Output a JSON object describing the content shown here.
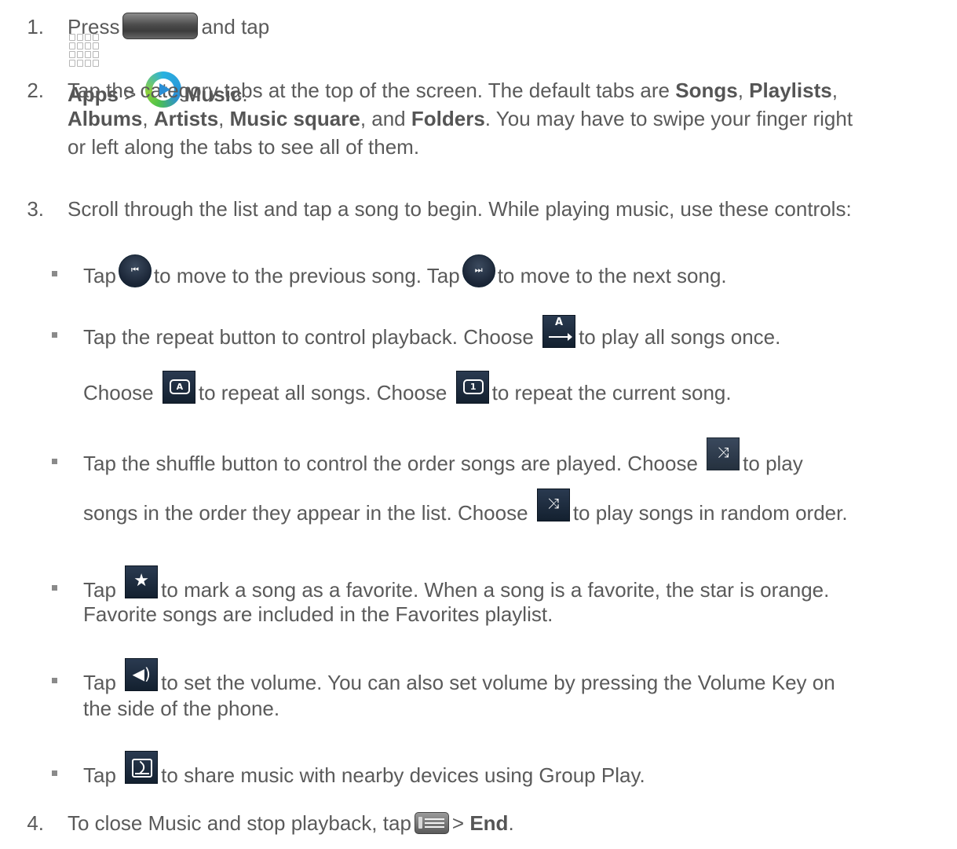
{
  "step1": {
    "num": "1.",
    "press": "Press",
    "and_tap": "and tap",
    "apps": "Apps",
    "gt": ">",
    "music": "Music",
    "period": "."
  },
  "step2": {
    "num": "2.",
    "a": "Tap the category tabs at the top of the screen. The default tabs are",
    "songs": "Songs",
    "comma1": ",",
    "playlists": "Playlists",
    "comma2": ",",
    "albums": "Albums",
    "sep1": ",",
    "artists": "Artists",
    "sep2": ",",
    "music_square": "Music square",
    "and": ", and",
    "folders": "Folders",
    "b": ". You may have to swipe your finger right",
    "c": "or left along the tabs to see all of them."
  },
  "step3": {
    "num": "3.",
    "text": "Scroll through the list and tap a song to begin. While playing music, use these controls:",
    "bullets": {
      "prev_next": {
        "tap1": "Tap",
        "prev": "to move to the previous song. Tap",
        "next": "to move to the next song."
      },
      "repeat": {
        "a": "Tap the repeat button to control playback. Choose",
        "b": "to play all songs once.",
        "choose2": "Choose",
        "c": "to repeat all songs. Choose",
        "d": "to repeat the current song."
      },
      "shuffle": {
        "a": "Tap the shuffle button to control the order songs are played. Choose",
        "b": "to play",
        "c": "songs in the order they appear in the list. Choose",
        "d": "to play songs in random order."
      },
      "favorite": {
        "tap": "Tap",
        "a": "to mark a song as a favorite. When a song is a favorite, the star is orange.",
        "b": "Favorite songs are included in the Favorites playlist."
      },
      "volume": {
        "tap": "Tap",
        "a": "to set the volume. You can also set volume by pressing the Volume Key on",
        "b": "the side of the phone."
      },
      "group_play": {
        "tap": "Tap",
        "a": "to share music with nearby devices using Group Play."
      }
    },
    "icons": {
      "prev": "⏮",
      "next": "⏭",
      "repeat_off_letter": "A",
      "repeat_all": "A",
      "repeat_one": "1",
      "shuffle": "⤨",
      "star": "★",
      "volume": "◀)"
    }
  },
  "step4": {
    "num": "4.",
    "a": "To close Music and stop playback, tap",
    "gt": ">",
    "end": "End",
    "period": "."
  }
}
